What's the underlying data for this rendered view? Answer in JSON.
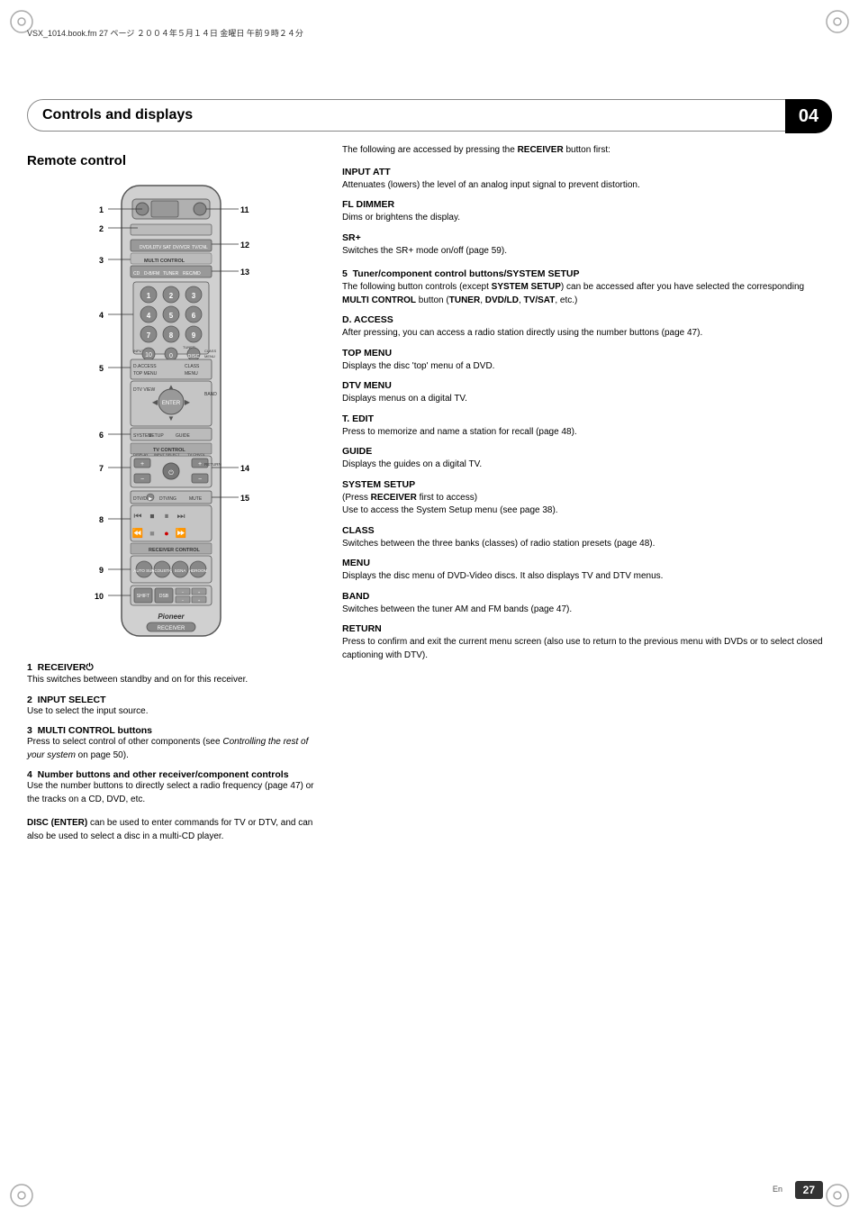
{
  "header": {
    "title": "Controls and displays",
    "chapter": "04",
    "jp_text": "VSX_1014.book.fm  27 ページ  ２００４年５月１４日  金曜日  午前９時２４分"
  },
  "page_number": "27",
  "page_lang": "En",
  "left": {
    "section_title": "Remote control",
    "callout_numbers": [
      "1",
      "2",
      "3",
      "4",
      "5",
      "6",
      "7",
      "8",
      "9",
      "10",
      "11",
      "12",
      "13",
      "14",
      "15"
    ],
    "descriptions": [
      {
        "num": "1",
        "title": "RECEIVER⏻",
        "body": "This switches between standby and on for this receiver."
      },
      {
        "num": "2",
        "title": "INPUT SELECT",
        "body": "Use to select the input source."
      },
      {
        "num": "3",
        "title": "MULTI CONTROL buttons",
        "body": "Press to select control of other components (see Controlling the rest of your system on page 50).",
        "italic_part": "Controlling the rest of your system"
      },
      {
        "num": "4",
        "title": "Number buttons and other receiver/component controls",
        "body": "Use the number buttons to directly select a radio frequency (page 47) or the tracks on a CD, DVD, etc.",
        "extra": "DISC (ENTER) can be used to enter commands for TV or DTV, and can also be used to select a disc in a multi-CD player."
      }
    ]
  },
  "right": {
    "intro": "The following are accessed by pressing the RECEIVER button first:",
    "items": [
      {
        "id": "input_att",
        "title": "INPUT ATT",
        "body": "Attenuates (lowers) the level of an analog input signal to prevent distortion."
      },
      {
        "id": "fl_dimmer",
        "title": "FL DIMMER",
        "body": "Dims or brightens the display."
      },
      {
        "id": "sr_plus",
        "title": "SR+",
        "body": "Switches the SR+ mode on/off (page 59)."
      },
      {
        "id": "tuner_section",
        "title": "5   Tuner/component control buttons/SYSTEM SETUP",
        "body": "The following button controls (except SYSTEM SETUP) can be accessed after you have selected the corresponding MULTI CONTROL button (TUNER, DVD/LD, TV/SAT, etc.)"
      },
      {
        "id": "d_access",
        "title": "D. ACCESS",
        "body": "After pressing, you can access a radio station directly using the number buttons (page 47)."
      },
      {
        "id": "top_menu",
        "title": "TOP MENU",
        "body": "Displays the disc 'top' menu of a DVD."
      },
      {
        "id": "dtv_menu",
        "title": "DTV MENU",
        "body": "Displays menus on a digital TV."
      },
      {
        "id": "t_edit",
        "title": "T. EDIT",
        "body": "Press to memorize and name a station for recall (page 48)."
      },
      {
        "id": "guide",
        "title": "GUIDE",
        "body": "Displays the guides on a digital TV."
      },
      {
        "id": "system_setup",
        "title": "SYSTEM SETUP",
        "body_prefix": "(Press RECEIVER first to access)",
        "body": "Use to access the System Setup menu (see page 38)."
      },
      {
        "id": "class",
        "title": "CLASS",
        "body": "Switches between the three banks (classes) of radio station presets (page 48)."
      },
      {
        "id": "menu",
        "title": "MENU",
        "body": "Displays the disc menu of DVD-Video discs. It also displays TV and DTV menus."
      },
      {
        "id": "band",
        "title": "BAND",
        "body": "Switches between the tuner AM and FM bands (page 47)."
      },
      {
        "id": "return",
        "title": "RETURN",
        "body": "Press to confirm and exit the current menu screen (also use to return to the previous menu with DVDs or to select closed captioning with DTV)."
      }
    ]
  }
}
